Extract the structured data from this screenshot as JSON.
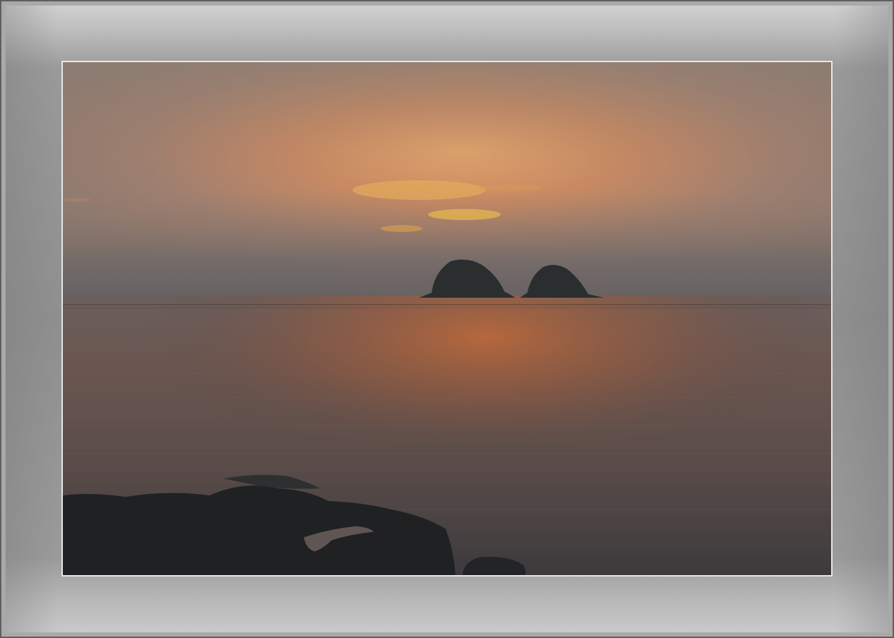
{
  "image": {
    "subject": "sunset-over-sea",
    "colors": {
      "frame": "#8e8e8e",
      "frame_highlight": "#d0d0d0",
      "photo_border": "#e8e8e8",
      "sky_top": "#8f8074",
      "sky_glow": "#e3a36a",
      "horizon": "#6e6764",
      "water": "#5d4f4a",
      "water_reflection": "#b8643a",
      "island": "#2a2e2f",
      "rock": "#1f2123"
    }
  }
}
